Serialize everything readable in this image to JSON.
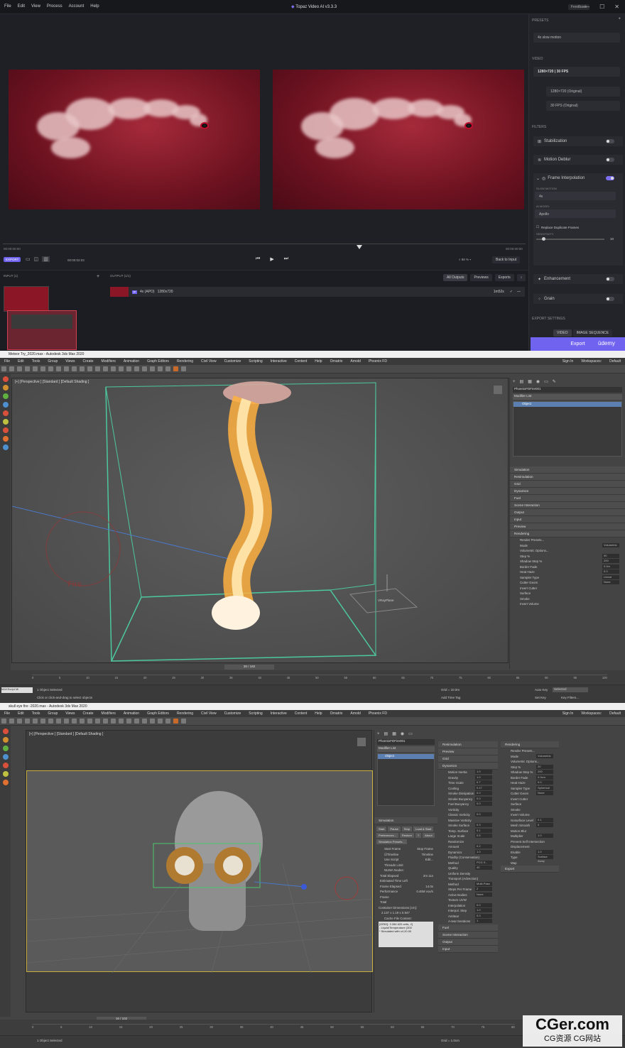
{
  "topaz": {
    "menu": [
      "File",
      "Edit",
      "View",
      "Process",
      "Account",
      "Help"
    ],
    "app_title": "Topaz Video AI  v3.3.3",
    "feedback": "Feedback",
    "timeline": {
      "start": "00:00:00:00",
      "end": "00:00:00:00",
      "current": "00:00:02:03"
    },
    "export_small": "EXPORT",
    "zoom": "88 %",
    "back_to_input": "Back to Input",
    "input_label": "INPUT (1)",
    "output_label": "OUTPUT (1/1)",
    "output_tabs": [
      "All Outputs",
      "Previews",
      "Exports"
    ],
    "output_item": {
      "name": "4x (APO)",
      "res": "1280x720",
      "time": "1m52s"
    },
    "sidebar": {
      "presets_label": "PRESETS",
      "preset_value": "4x slow motion",
      "video_label": "VIDEO",
      "video_summary": "1280×720  |  30 FPS",
      "res_value": "1280×720 (Original)",
      "fps_value": "30 FPS (Original)",
      "filters_label": "FILTERS",
      "stabilization": "Stabilization",
      "motion_deblur": "Motion Deblur",
      "frame_interp": "Frame Interpolation",
      "slow_motion_label": "SLOW MOTION",
      "slow_motion_value": "4x",
      "ai_model_label": "AI MODEL",
      "ai_model_value": "Apollo",
      "replace_dup": "Replace Duplicate Frames",
      "sensitivity_label": "SENSITIVITY",
      "sensitivity_value": "10",
      "enhancement": "Enhancement",
      "grain": "Grain",
      "export_settings": "EXPORT SETTINGS",
      "export_tabs": [
        "VIDEO",
        "IMAGE SEQUENCE"
      ],
      "export_button": "Export",
      "udemy": "ūdemy"
    }
  },
  "max1": {
    "title": "Meteor Try_2020.max - Autodesk 3ds Max 2020",
    "menu": [
      "File",
      "Edit",
      "Tools",
      "Group",
      "Views",
      "Create",
      "Modifiers",
      "Animation",
      "Graph Editors",
      "Rendering",
      "Civil View",
      "Customize",
      "Scripting",
      "Interactive",
      "Content",
      "Help",
      "Ornatrix",
      "Arnold",
      "Phoenix FD"
    ],
    "sign_in": "Sign In",
    "workspaces": "Workspaces:",
    "workspace_value": "Default",
    "view_label": "[+] [Perspective ] [Standard ] [Default Shading ]",
    "object_name": "PhoenixFDFire001",
    "modifier_list": "Modifier List",
    "stack_item": "Object",
    "rollouts": [
      "Simulation",
      "Resimulation",
      "Grid",
      "Dynamics",
      "Fuel",
      "Scene Interaction",
      "Output",
      "Input",
      "Preview",
      "Rendering"
    ],
    "render_props": [
      {
        "label": "Render Presets...",
        "value": ""
      },
      {
        "label": "Mode",
        "value": "Volumetric"
      },
      {
        "label": "Volumetric Options...",
        "value": ""
      },
      {
        "label": "Step %",
        "value": "90"
      },
      {
        "label": "Shadow Step %",
        "value": "200"
      },
      {
        "label": "Border Fade",
        "value": "0.0m"
      },
      {
        "label": "Heat Haze",
        "value": "0.0"
      },
      {
        "label": "Sampler Type",
        "value": "Linear"
      },
      {
        "label": "Cutter Geom",
        "value": "None"
      },
      {
        "label": "Invert Cutter",
        "value": ""
      },
      {
        "label": "Surface",
        "value": ""
      },
      {
        "label": "Smoke",
        "value": ""
      },
      {
        "label": "Invert Volume",
        "value": ""
      }
    ],
    "plane_label": "VRayPlane",
    "fire_logo": "Fire",
    "frame_counter": "38 / 160",
    "timeline_ticks": [
      "0",
      "5",
      "10",
      "15",
      "20",
      "25",
      "30",
      "35",
      "40",
      "45",
      "50",
      "55",
      "60",
      "65",
      "70",
      "75",
      "80",
      "85",
      "90",
      "95",
      "100"
    ],
    "status1": "1 Object Selected",
    "status2": "Click or click-and-drag to select objects",
    "grid": "Grid = 10.0m",
    "add_time_tag": "Add Time Tag",
    "auto_key": "Auto Key",
    "selected": "Selected",
    "set_key": "Set Key",
    "key_filters": "Key Filters...",
    "maxscript": "MAXScript Mi"
  },
  "max2": {
    "title": "skull eye fire -2020.max - Autodesk 3ds Max 2020",
    "view_label": "[+] [Perspective ] [Standard ] [Default Shading ]",
    "object_name": "PhoenixFDFire001",
    "modifier_list": "Modifier List",
    "stack_item": "Object",
    "sim_rollout": "Simulation",
    "sim_buttons": [
      "Start",
      "Pause",
      "Stop",
      "Load & Start",
      "Preferences...",
      "Restore",
      "?",
      "About",
      "Simulation Presets..."
    ],
    "start_frame": "Start Frame",
    "stop_frame": "Stop Frame",
    "timeline_chk": "Timeline",
    "use_script": "Use Script",
    "edit": "Edit...",
    "threads_limit": "Threads Limit",
    "numa": "NUMA Nodes:",
    "stats": [
      {
        "label": "Total Elapsed",
        "value": "2m 11s"
      },
      {
        "label": "Estimated Time Left",
        "value": ""
      },
      {
        "label": "Frame Elapsed",
        "value": "14.0s"
      },
      {
        "label": "Performance",
        "value": "0.46M vox/s"
      },
      {
        "label": "Frame",
        "value": ""
      },
      {
        "label": "Total",
        "value": ""
      }
    ],
    "container_dims_label": "Container Dimensions [cm]:",
    "container_dims": "2.137 x 1.19 x 0.947",
    "cache_content": "Cache File Content:",
    "cache_lines": [
      "[GRID]: 3 284 620 cells, 2[",
      "- Liquid/Temperature (300",
      "* Simulated with v4.20.00"
    ],
    "col2_rollouts": [
      "Resimulation",
      "Preview",
      "Grid",
      "Dynamics"
    ],
    "dyn_props": [
      {
        "label": "Motion Inertia",
        "value": "1.0"
      },
      {
        "label": "Gravity",
        "value": "1.0"
      },
      {
        "label": "Time Scale",
        "value": "0.7"
      },
      {
        "label": "Cooling",
        "value": "0.17"
      },
      {
        "label": "Smoke Dissipation",
        "value": "0.0"
      },
      {
        "label": "Smoke Buoyancy",
        "value": "0.0"
      },
      {
        "label": "Fuel Buoyancy",
        "value": "0.0"
      },
      {
        "label": "Vorticity",
        "value": ""
      },
      {
        "label": "Classic Vorticity",
        "value": "0.0"
      },
      {
        "label": "Massive Vorticity",
        "value": ""
      },
      {
        "label": "Smoke Surface",
        "value": "0.3"
      },
      {
        "label": "Temp. Surface",
        "value": "0.1"
      },
      {
        "label": "Large Scale",
        "value": "0.5"
      },
      {
        "label": "Randomize",
        "value": ""
      },
      {
        "label": "Amount",
        "value": "0.2"
      },
      {
        "label": "Dynamics",
        "value": "1.0"
      },
      {
        "label": "Fluidity (Conservation)",
        "value": ""
      },
      {
        "label": "Method",
        "value": "PCG S - sym"
      },
      {
        "label": "Quality",
        "value": "40"
      },
      {
        "label": "Uniform Density",
        "value": ""
      },
      {
        "label": "Transport (Advection)",
        "value": ""
      },
      {
        "label": "Method",
        "value": "Multi-Pass"
      },
      {
        "label": "Steps Per Frame",
        "value": "2"
      },
      {
        "label": "Active Bodies",
        "value": "None"
      },
      {
        "label": "Texture UVW",
        "value": ""
      },
      {
        "label": "Interpolation",
        "value": "0.0"
      },
      {
        "label": "Interpol. Step",
        "value": "1.0"
      },
      {
        "label": "Antitear",
        "value": "0.0"
      },
      {
        "label": "A-tear Iterations",
        "value": "1"
      }
    ],
    "col2_bottom": [
      "Fuel",
      "Scene Interaction",
      "Output",
      "Input"
    ],
    "col3_title": "Rendering",
    "col3_props": [
      {
        "label": "Render Presets...",
        "value": ""
      },
      {
        "label": "Mode",
        "value": "Volumetric"
      },
      {
        "label": "Volumetric Options...",
        "value": ""
      },
      {
        "label": "Step %",
        "value": "20"
      },
      {
        "label": "Shadow Step %",
        "value": "200"
      },
      {
        "label": "Border Fade",
        "value": "0.0cm"
      },
      {
        "label": "Heat Haze",
        "value": "0.0"
      },
      {
        "label": "Sampler Type",
        "value": "Spherical"
      },
      {
        "label": "Cutter Geom",
        "value": "None"
      },
      {
        "label": "Invert Cutter",
        "value": ""
      },
      {
        "label": "Surface",
        "value": ""
      },
      {
        "label": "Smoke",
        "value": ""
      },
      {
        "label": "Invert Volume",
        "value": ""
      },
      {
        "label": "Isosurface Level",
        "value": "0.1"
      },
      {
        "label": "Mesh Smooth",
        "value": "0"
      },
      {
        "label": "Motion Blur",
        "value": ""
      },
      {
        "label": "Multiplier",
        "value": "1.0"
      },
      {
        "label": "Prevent Self Intersection",
        "value": ""
      },
      {
        "label": "Displacement",
        "value": ""
      },
      {
        "label": "Enable",
        "value": "1.0"
      },
      {
        "label": "Type",
        "value": "Surface Away"
      },
      {
        "label": "Map",
        "value": ""
      }
    ],
    "col3_export": "Export",
    "frame_counter": "16 / 102",
    "timeline_ticks": [
      "0",
      "5",
      "10",
      "15",
      "20",
      "25",
      "30",
      "35",
      "40",
      "45",
      "50",
      "55",
      "60",
      "65",
      "70",
      "75",
      "80"
    ],
    "status1": "1 Object Selected",
    "grid": "Grid = 1.0cm",
    "sign_in": "Sign In",
    "workspaces": "Workspaces:",
    "workspace_value": "Default"
  },
  "watermark": {
    "main": "CGer.com",
    "sub": "CG资源 CG网站"
  },
  "colors": {
    "accent": "#6f63f0",
    "max_bg": "#444444",
    "topaz_bg": "#1e1f25"
  }
}
